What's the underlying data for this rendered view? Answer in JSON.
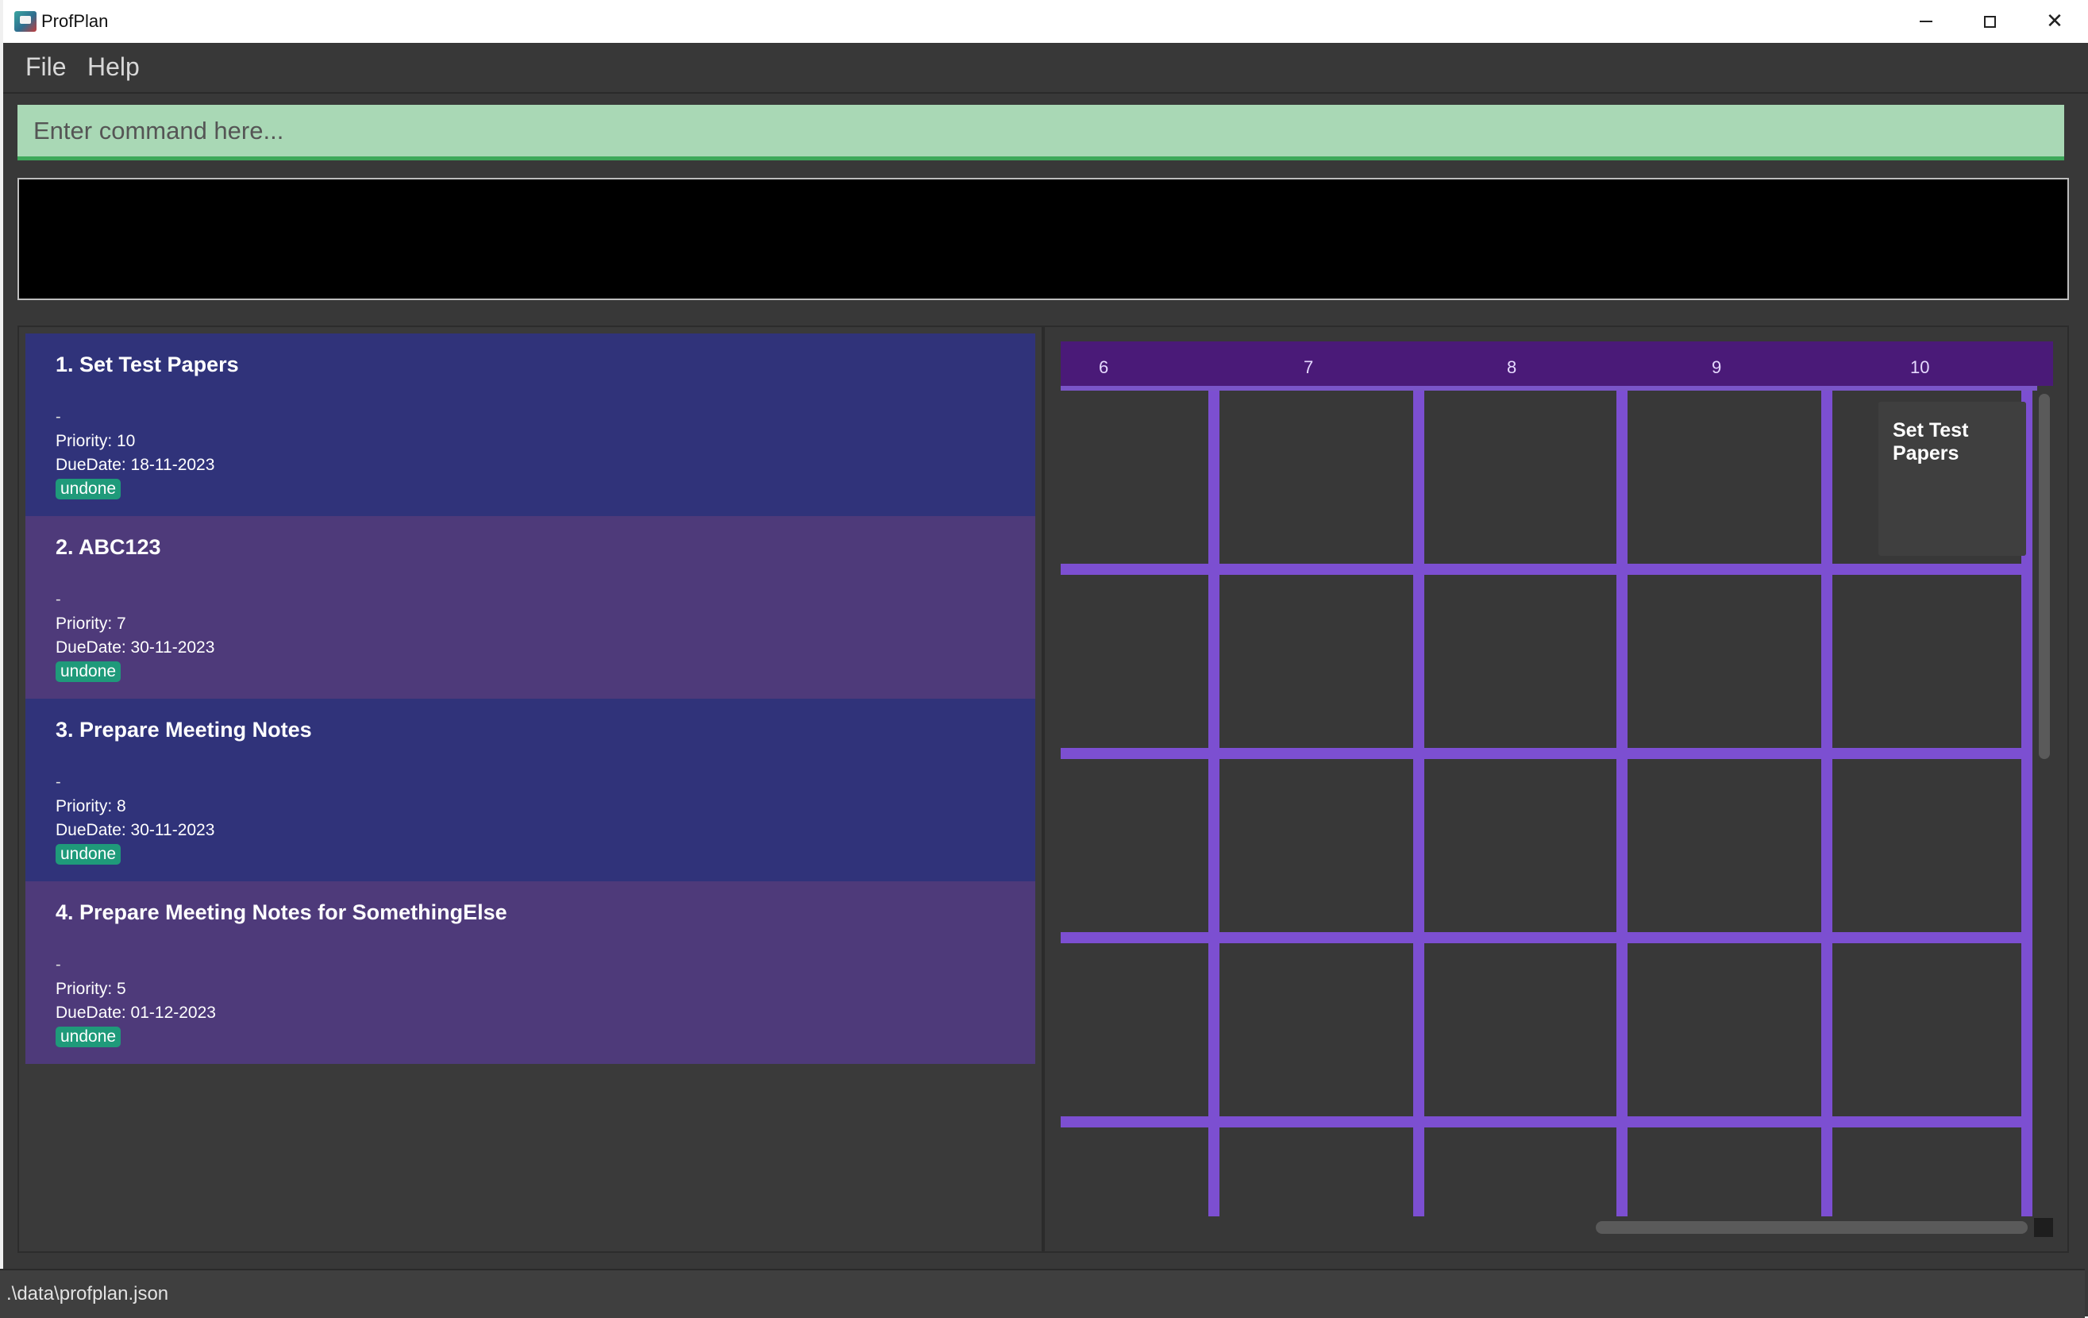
{
  "window": {
    "title": "ProfPlan",
    "controls": {
      "minimize": "minimize-icon",
      "maximize": "maximize-icon",
      "close": "close-icon"
    }
  },
  "menu": {
    "file": "File",
    "help": "Help"
  },
  "command": {
    "placeholder": "Enter command here...",
    "value": ""
  },
  "result": {
    "text": ""
  },
  "tasks": [
    {
      "index": "1.",
      "name": "Set Test Papers",
      "title": "1.  Set Test Papers",
      "description": "-",
      "priority": "Priority: 10",
      "due": "DueDate: 18-11-2023",
      "status": "undone"
    },
    {
      "index": "2.",
      "name": "ABC123",
      "title": "2.  ABC123",
      "description": "-",
      "priority": "Priority: 7",
      "due": "DueDate: 30-11-2023",
      "status": "undone"
    },
    {
      "index": "3.",
      "name": "Prepare Meeting Notes",
      "title": "3.  Prepare Meeting Notes",
      "description": "-",
      "priority": "Priority: 8",
      "due": "DueDate: 30-11-2023",
      "status": "undone"
    },
    {
      "index": "4.",
      "name": "Prepare Meeting Notes for SomethingElse",
      "title": "4.  Prepare Meeting Notes for SomethingElse",
      "description": "-",
      "priority": "Priority: 5",
      "due": "DueDate: 01-12-2023",
      "status": "undone"
    }
  ],
  "calendar": {
    "days": [
      "6",
      "7",
      "8",
      "9",
      "10"
    ],
    "events": [
      {
        "day": "10",
        "title": "Set Test Papers"
      }
    ],
    "colors": {
      "header": "#4a1a78",
      "grid": "#7c4fd1",
      "tag": "#1f9a7a"
    }
  },
  "status": {
    "file_path": ".\\data\\profplan.json"
  }
}
